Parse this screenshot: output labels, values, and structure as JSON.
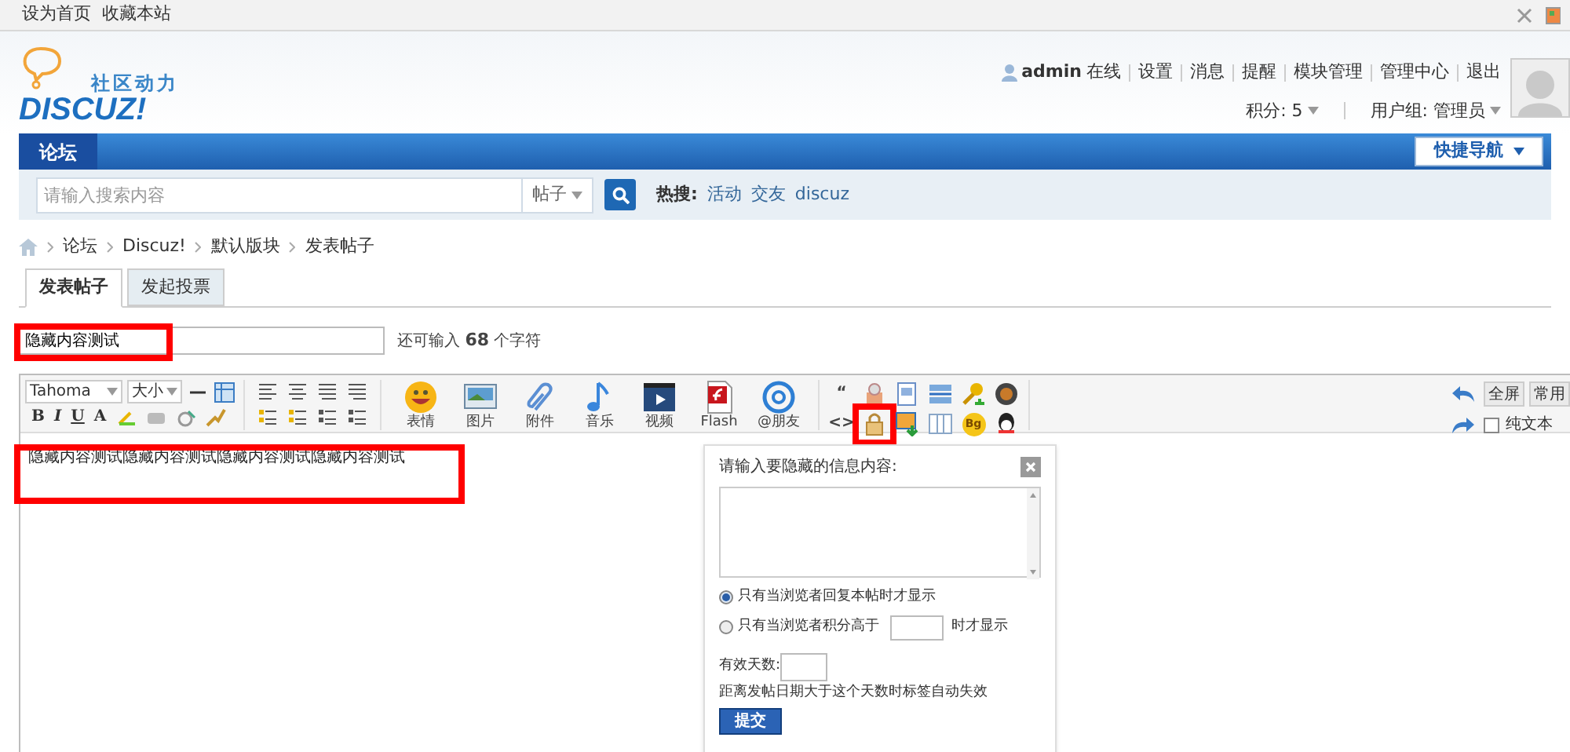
{
  "top_bar": {
    "links": [
      "设为首页",
      "收藏本站"
    ]
  },
  "logo": {
    "tagline": "社区动力",
    "wordmark": "DISCUZ!"
  },
  "user": {
    "name": "admin",
    "status": "在线",
    "links": [
      "设置",
      "消息",
      "提醒",
      "模块管理",
      "管理中心",
      "退出"
    ],
    "credits": "积分: 5",
    "group": "用户组: 管理员"
  },
  "nav": {
    "items": [
      {
        "label": "论坛",
        "selected": true
      }
    ],
    "quick_nav": "快捷导航"
  },
  "search": {
    "placeholder": "请输入搜索内容",
    "type": "帖子",
    "hot_label": "热搜:",
    "hot": [
      "活动",
      "交友",
      "discuz"
    ]
  },
  "breadcrumb": [
    "论坛",
    "Discuz!",
    "默认版块",
    "发表帖子"
  ],
  "tabs": [
    {
      "label": "发表帖子",
      "selected": true
    },
    {
      "label": "发起投票",
      "selected": false
    }
  ],
  "title_field": {
    "value": "隐藏内容测试",
    "highlighted": true
  },
  "char_hint": {
    "prefix": "还可输入",
    "count": "68",
    "suffix": "个字符"
  },
  "toolbar": {
    "font": "Tahoma",
    "size": "大小",
    "format": [
      "B",
      "I",
      "U",
      "A"
    ],
    "media": [
      {
        "label": "表情",
        "kind": "smiley"
      },
      {
        "label": "图片",
        "kind": "image"
      },
      {
        "label": "附件",
        "kind": "clip"
      },
      {
        "label": "音乐",
        "kind": "music"
      },
      {
        "label": "视频",
        "kind": "video"
      },
      {
        "label": "Flash",
        "kind": "flash"
      },
      {
        "label": "@朋友",
        "kind": "at"
      }
    ],
    "tools": [
      {
        "kind": "quote",
        "label": "“",
        "highlighted": false
      },
      {
        "kind": "free",
        "highlighted": false
      },
      {
        "kind": "page",
        "highlighted": false
      },
      {
        "kind": "hr",
        "highlighted": false
      },
      {
        "kind": "key",
        "highlighted": false
      },
      {
        "kind": "ball",
        "highlighted": false
      },
      {
        "kind": "code",
        "label": "<>",
        "highlighted": false
      },
      {
        "kind": "lock",
        "highlighted": true
      },
      {
        "kind": "image_down",
        "highlighted": false
      },
      {
        "kind": "columns",
        "highlighted": false
      },
      {
        "kind": "bg",
        "label": "Bg",
        "highlighted": false
      },
      {
        "kind": "qq",
        "highlighted": false
      }
    ],
    "fullscreen": "全屏",
    "common": "常用",
    "plain_text": {
      "label": "纯文本",
      "checked": false
    }
  },
  "editor": {
    "content": "隐藏内容测试隐藏内容测试隐藏内容测试隐藏内容测试",
    "highlighted": true
  },
  "hide_dialog": {
    "title": "请输入要隐藏的信息内容:",
    "options": [
      {
        "kind": "plain",
        "label": "只有当浏览者回复本帖时才显示",
        "selected": true
      },
      {
        "kind": "with_input",
        "label": "只有当浏览者积分高于",
        "suffix": "时才显示",
        "selected": false
      }
    ],
    "days_label": "有效天数:",
    "note": "距离发帖日期大于这个天数时标签自动失效",
    "submit": "提交"
  }
}
